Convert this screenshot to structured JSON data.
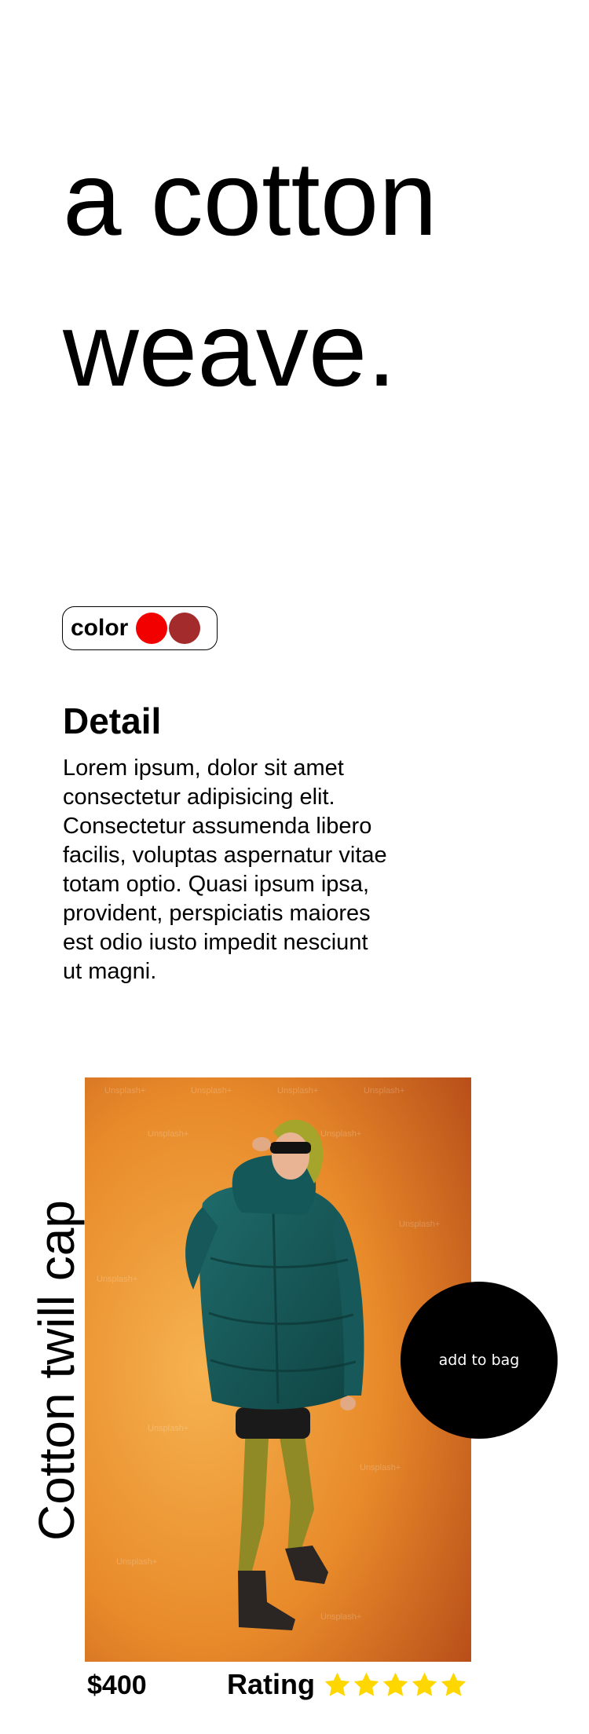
{
  "hero": {
    "line1": "a cotton",
    "line2": "weave."
  },
  "color": {
    "label": "color",
    "swatches": [
      {
        "name": "red",
        "hex": "#f20000"
      },
      {
        "name": "dark red",
        "hex": "#a32b2b"
      }
    ]
  },
  "detail": {
    "heading": "Detail",
    "text": "Lorem ipsum, dolor sit amet consectetur adipisicing elit. Consectetur assumenda libero facilis, voluptas aspernatur vitae totam optio. Quasi ipsum ipsa, provident, perspiciatis maiores est odio iusto impedit nesciunt ut magni."
  },
  "product": {
    "name": "Cotton twill cap",
    "image_watermark": "Unsplash+",
    "add_to_bag_label": "add to bag",
    "price": "$400",
    "rating_label": "Rating",
    "rating": 5,
    "rating_max": 5,
    "star_color": "#ffd700"
  }
}
